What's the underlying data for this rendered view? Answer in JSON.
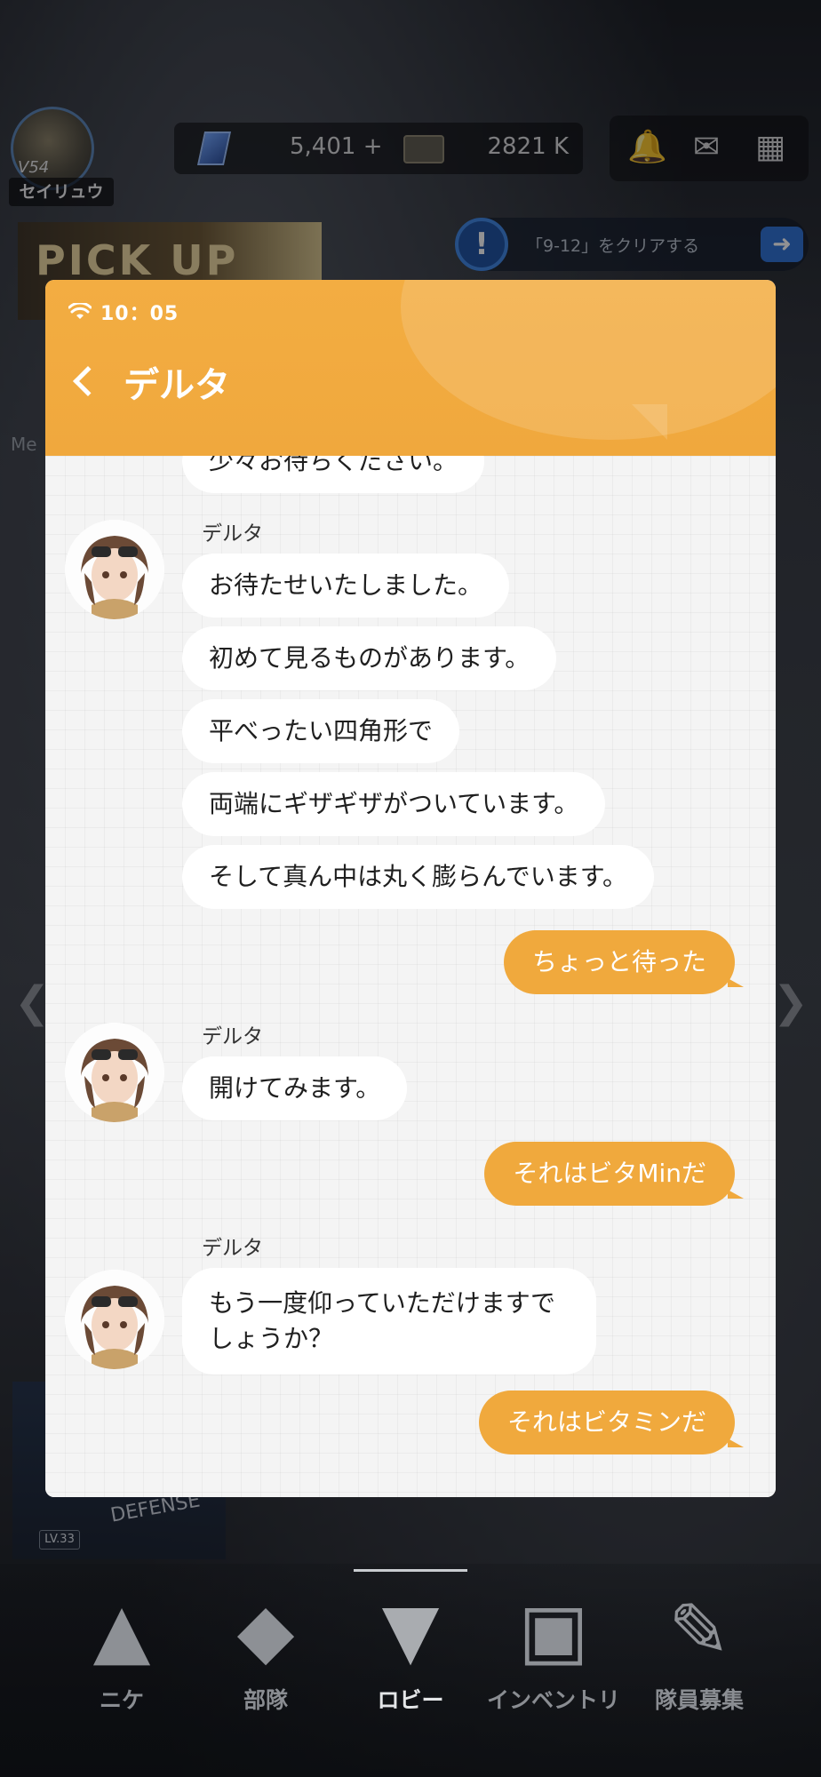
{
  "topbar": {
    "level": "54",
    "player_name": "セイリュウ",
    "gems": "5,401",
    "gem_plus": "+",
    "tickets": "2821 K"
  },
  "banner": {
    "pickup": "PICK UP"
  },
  "mission": {
    "text": "「9-12」をクリアする"
  },
  "side": {
    "me_label": "Me"
  },
  "defense": {
    "text": "DEFENSE",
    "level": "LV.33"
  },
  "nav": {
    "items": [
      {
        "label": "ニケ"
      },
      {
        "label": "部隊"
      },
      {
        "label": "ロビー"
      },
      {
        "label": "インベントリ"
      },
      {
        "label": "隊員募集"
      }
    ]
  },
  "modal": {
    "status_time": "10：05",
    "title": "デルタ",
    "messages": [
      {
        "from": "npc",
        "text": "少々お待ちください。"
      },
      {
        "from": "npc",
        "sender": "デルタ",
        "text": "お待たせいたしました。"
      },
      {
        "from": "npc",
        "text": "初めて見るものがあります。"
      },
      {
        "from": "npc",
        "text": "平べったい四角形で"
      },
      {
        "from": "npc",
        "text": "両端にギザギザがついています。"
      },
      {
        "from": "npc",
        "text": "そして真ん中は丸く膨らんでいます。"
      },
      {
        "from": "user",
        "text": "ちょっと待った"
      },
      {
        "from": "npc",
        "sender": "デルタ",
        "text": "開けてみます。"
      },
      {
        "from": "user",
        "text": "それはビタMinだ"
      },
      {
        "from": "npc",
        "sender": "デルタ",
        "text": "もう一度仰っていただけますでしょうか？"
      },
      {
        "from": "user",
        "text": "それはビタミンだ"
      }
    ]
  },
  "colors": {
    "accent": "#f0a93d",
    "header": "#f3ad42",
    "chat_bg": "#f4f4f4"
  }
}
